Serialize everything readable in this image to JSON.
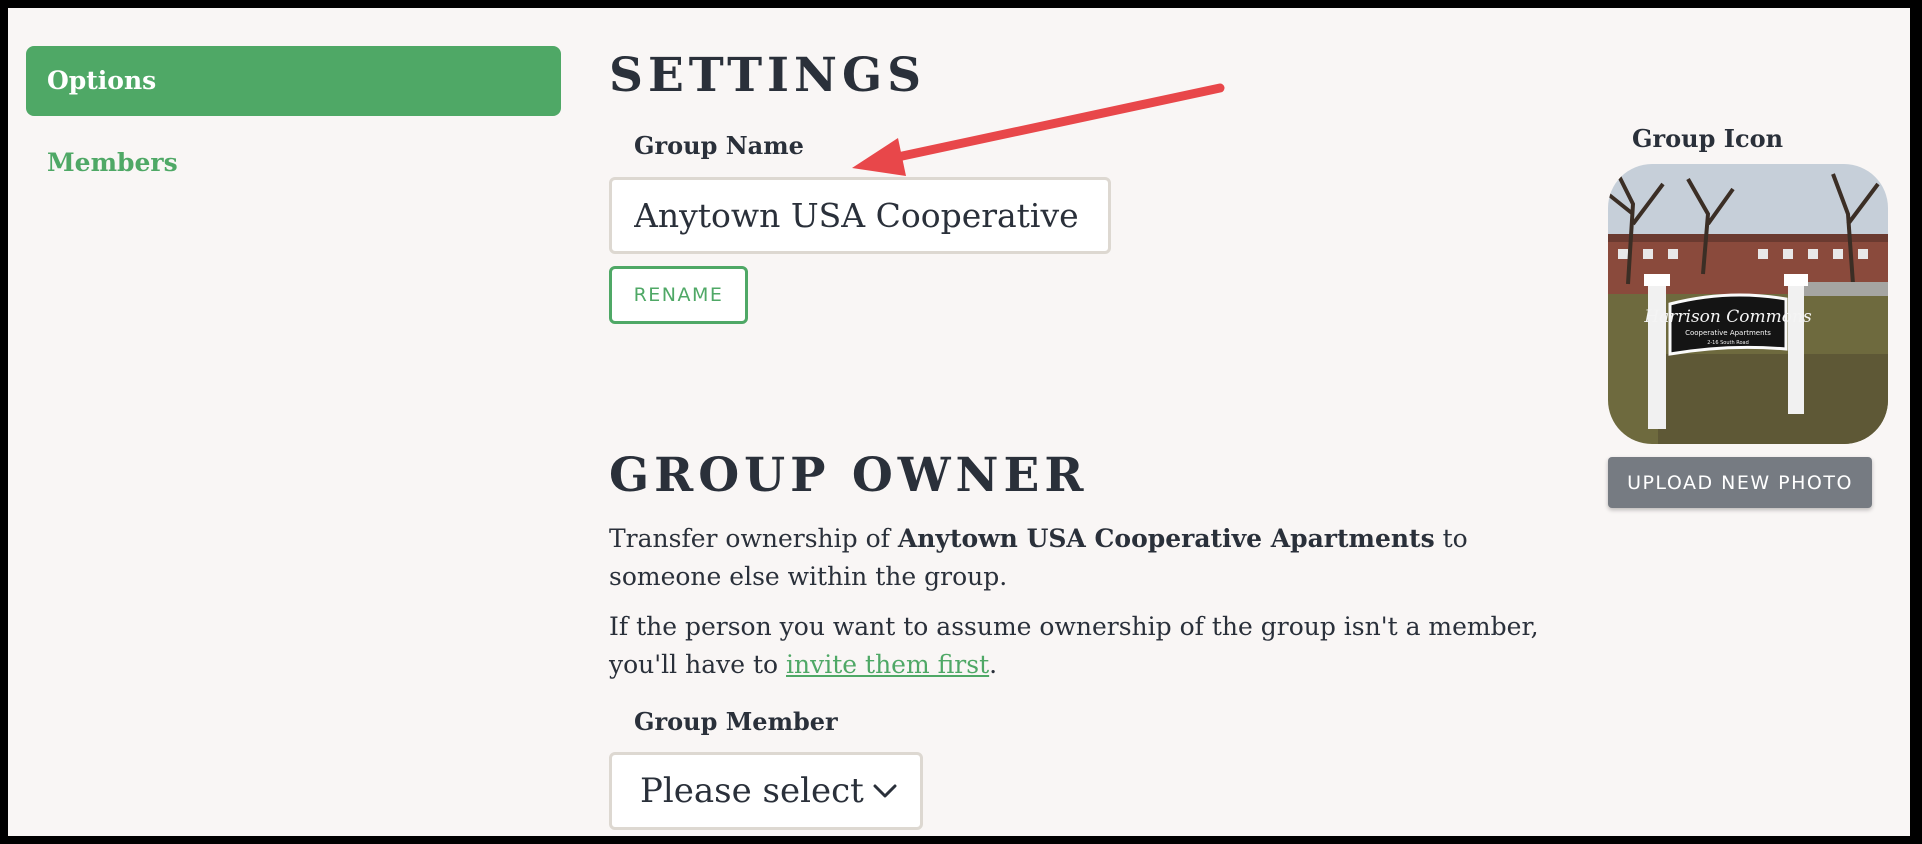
{
  "sidebar": {
    "items": [
      {
        "label": "Options"
      },
      {
        "label": "Members"
      }
    ]
  },
  "settings": {
    "title": "SETTINGS",
    "group_name_label": "Group Name",
    "group_name_value": "Anytown USA Cooperative Apartments",
    "rename_label": "RENAME"
  },
  "group_icon": {
    "label": "Group Icon",
    "photo_sign_text": "Harrison Commons",
    "photo_sign_sub": "Cooperative Apartments",
    "photo_sign_addr": "2-16 South Road",
    "upload_label": "UPLOAD NEW PHOTO"
  },
  "group_owner": {
    "title": "GROUP OWNER",
    "transfer_prefix": "Transfer ownership of ",
    "group_name_bold": "Anytown USA Cooperative Apartments",
    "transfer_suffix": " to someone else within the group.",
    "invite_prefix": "If the person you want to assume ownership of the group isn't a member, you'll have to ",
    "invite_link": "invite them first",
    "invite_suffix": ".",
    "member_label": "Group Member",
    "select_value": "Please select"
  },
  "colors": {
    "accent_green": "#4fa866",
    "annotation_arrow": "#e8474a",
    "text_dark": "#2a303a",
    "button_gray": "#767b82"
  }
}
